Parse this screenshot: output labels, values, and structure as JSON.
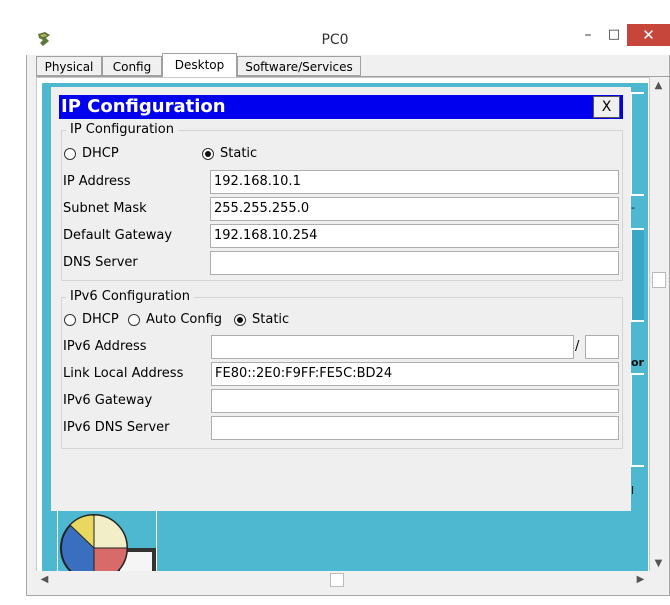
{
  "window": {
    "title": "PC0",
    "minimize_glyph": "–",
    "maximize_glyph": "□",
    "close_glyph": "✕"
  },
  "tabs": [
    {
      "label": "Physical"
    },
    {
      "label": "Config"
    },
    {
      "label": "Desktop",
      "active": true
    },
    {
      "label": "Software/Services"
    }
  ],
  "dialog": {
    "title": "IP Configuration",
    "close_label": "X",
    "ipv4": {
      "group_label": "IP Configuration",
      "dhcp_label": "DHCP",
      "static_label": "Static",
      "selected": "Static",
      "ip_label": "IP Address",
      "ip_value": "192.168.10.1",
      "mask_label": "Subnet Mask",
      "mask_value": "255.255.255.0",
      "gateway_label": "Default Gateway",
      "gateway_value": "192.168.10.254",
      "dns_label": "DNS Server",
      "dns_value": ""
    },
    "ipv6": {
      "group_label": "IPv6 Configuration",
      "dhcp_label": "DHCP",
      "auto_label": "Auto Config",
      "static_label": "Static",
      "selected": "Static",
      "address_label": "IPv6 Address",
      "address_value": "",
      "slash": "/",
      "prefix_value": "",
      "link_local_label": "Link Local Address",
      "link_local_value": "FE80::2E0:F9FF:FE5C:BD24",
      "gateway_label": "IPv6 Gateway",
      "gateway_value": "",
      "dns_label": "IPv6 DNS Server",
      "dns_value": ""
    }
  },
  "background_peek": {
    "or_text": "or",
    "dash1": "-",
    "dash2": "l"
  },
  "scrollbars": {
    "up": "▲",
    "down": "▼",
    "left": "◀",
    "right": "▶"
  },
  "colors": {
    "dialog_title_bg": "#0000ee",
    "desktop_bg": "#4db8cf",
    "close_button_bg": "#c7463b"
  }
}
